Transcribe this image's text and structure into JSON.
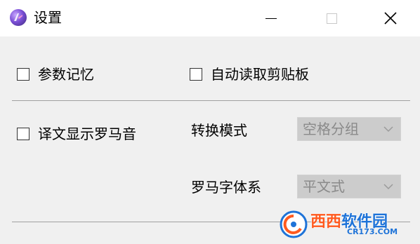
{
  "window": {
    "title": "设置",
    "icon": "app-logo-icon"
  },
  "titlebar_controls": {
    "minimize_icon": "minimize-icon",
    "maximize_icon": "maximize-icon",
    "close_icon": "close-icon"
  },
  "options": {
    "remember_params": {
      "label": "参数记忆",
      "checked": false
    },
    "auto_read_clipboard": {
      "label": "自动读取剪贴板",
      "checked": false
    },
    "show_romaji": {
      "label": "译文显示罗马音",
      "checked": false
    }
  },
  "fields": {
    "conversion_mode": {
      "label": "转换模式",
      "value": "空格分组",
      "disabled": true
    },
    "romaji_font": {
      "label": "罗马字体系",
      "value": "平文式",
      "disabled": true
    }
  },
  "watermark": {
    "text_orange": "西西",
    "text_blue": "软件园",
    "subtext": "CR173.COM"
  },
  "colors": {
    "titlebar_bg": "#ffffff",
    "window_bg": "#f0f0f0",
    "disabled_select_bg": "#cccccc",
    "disabled_text": "#8a8a8a",
    "watermark_orange": "#ff5a1f",
    "watermark_blue": "#1e73d8"
  }
}
